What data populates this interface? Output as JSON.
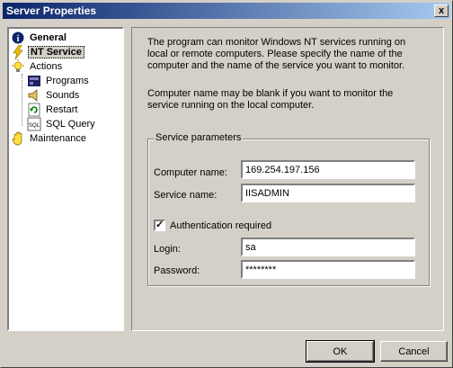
{
  "window": {
    "title": "Server Properties",
    "close_glyph": "x"
  },
  "tree": {
    "items": [
      {
        "label": "General",
        "icon": "info-icon",
        "glyph": "i",
        "color": "#0a246a"
      },
      {
        "label": "NT Service",
        "icon": "lightning-icon",
        "glyph": "⚡",
        "color": "#e0a800"
      },
      {
        "label": "Actions",
        "icon": "lightbulb-icon",
        "glyph": "☀",
        "color": "#e0c000"
      },
      {
        "label": "Programs",
        "icon": "programs-icon",
        "glyph": "▦",
        "color": "#202060"
      },
      {
        "label": "Sounds",
        "icon": "speaker-icon",
        "glyph": "◀",
        "color": "#806000"
      },
      {
        "label": "Restart",
        "icon": "restart-icon",
        "glyph": "↻",
        "color": "#008000"
      },
      {
        "label": "SQL Query",
        "icon": "sql-icon",
        "glyph": "SQL",
        "color": "#404040"
      },
      {
        "label": "Maintenance",
        "icon": "hand-icon",
        "glyph": "✋",
        "color": "#e0c000"
      }
    ]
  },
  "info": {
    "paragraph1": "The program can monitor Windows NT services running on local or remote computers. Please specify the name of the computer and the name of the service you want to monitor.",
    "paragraph2": "Computer name may be blank if you want to monitor the service running on the local computer."
  },
  "service_params": {
    "group_title": "Service parameters",
    "computer_label": "Computer name:",
    "computer_value": "169.254.197.156",
    "service_label": "Service name:",
    "service_value": "IISADMIN",
    "auth_label": "Authentication required",
    "auth_checked": true,
    "check_glyph": "✓",
    "login_label": "Login:",
    "login_value": "sa",
    "password_label": "Password:",
    "password_value": "********"
  },
  "buttons": {
    "ok": "OK",
    "cancel": "Cancel"
  }
}
